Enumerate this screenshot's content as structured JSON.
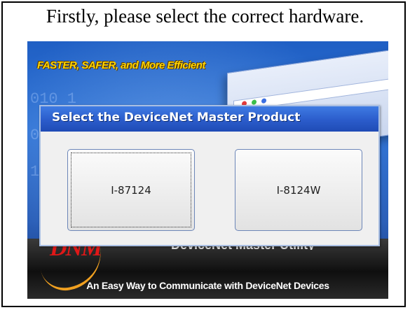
{
  "instruction": "Firstly, please select the correct hardware.",
  "splash": {
    "tagline": "FASTER, SAFER, and More Efficient",
    "binary_digits": "010 1\n 1 0\n0 1 10\n 0  1\n1 01",
    "logo_text": "DNM",
    "utility_title": "DeviceNet Master Utility",
    "slogan": "An Easy Way to Communicate with DeviceNet Devices"
  },
  "dialog": {
    "title": "Select the DeviceNet Master Product",
    "buttons": [
      {
        "label": "I-87124"
      },
      {
        "label": "I-8124W"
      }
    ]
  },
  "colors": {
    "titlebar": "#2b5ccb",
    "tagline": "#ffd400",
    "logo": "#e01818"
  }
}
